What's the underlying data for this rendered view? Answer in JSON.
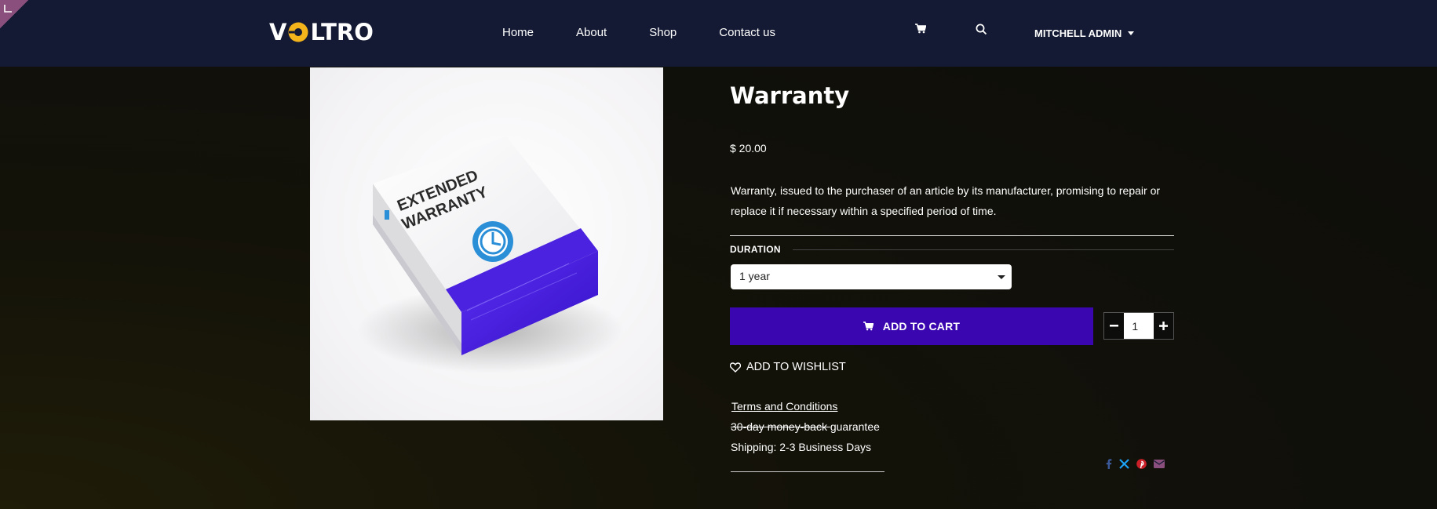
{
  "header": {
    "logo_text_pre": "V",
    "logo_text_post": "LTRO",
    "nav": [
      {
        "label": "Home"
      },
      {
        "label": "About"
      },
      {
        "label": "Shop"
      },
      {
        "label": "Contact us"
      }
    ],
    "user_name": "MITCHELL ADMIN",
    "icons": {
      "cart": "cart-icon",
      "search": "search-icon",
      "user_caret": "chevron-down-icon"
    }
  },
  "product": {
    "image_text_line1": "EXTENDED",
    "image_text_line2": "WARRANTY",
    "title": "Warranty",
    "price": "$ 20.00",
    "description": "Warranty, issued to the purchaser of an article by its manufacturer, promising to repair or replace it if necessary within a specified period of time.",
    "attribute_label": "DURATION",
    "attribute_value": "1 year",
    "add_to_cart_label": "ADD TO CART",
    "quantity": "1",
    "wishlist_label": "ADD TO WISHLIST",
    "terms_label": "Terms and Conditions",
    "guarantee_struck": "30-day money-back ",
    "guarantee_rest": "guarantee",
    "shipping": "Shipping: 2-3 Business Days",
    "share_icons": [
      "facebook-icon",
      "x-icon",
      "pinterest-icon",
      "email-icon"
    ]
  },
  "colors": {
    "header_bg": "#141a33",
    "primary": "#3a06b0",
    "facebook": "#3b5998",
    "x": "#1da1f2",
    "pinterest": "#cb2027",
    "email": "#8a4f7d"
  }
}
